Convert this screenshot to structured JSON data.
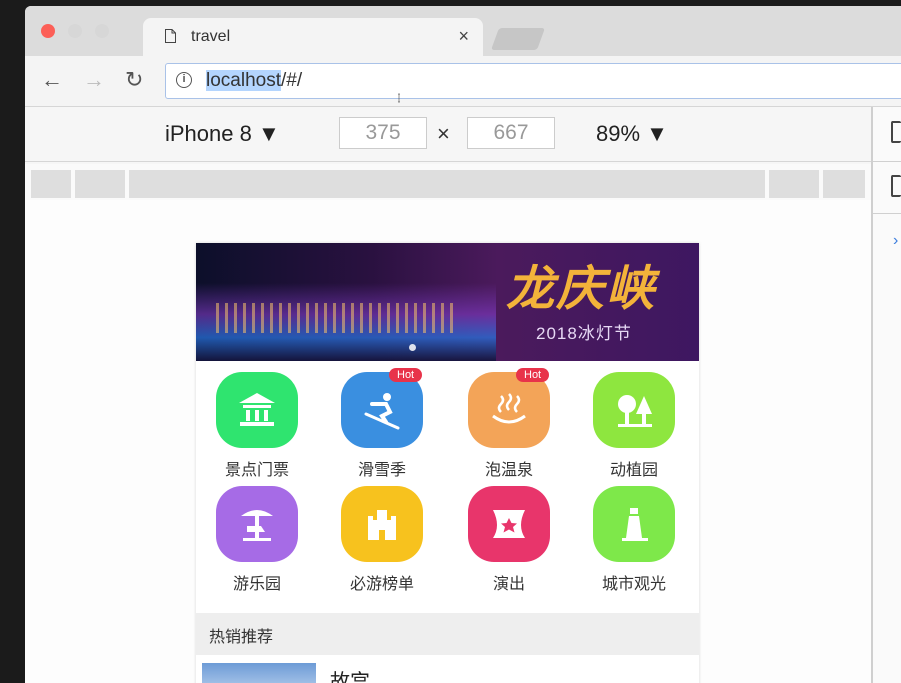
{
  "browser": {
    "tab_title": "travel",
    "tab_close": "×",
    "url_host": "localhost",
    "url_rest": "/#/",
    "nav": {
      "back": "←",
      "forward": "→",
      "reload": "↻"
    }
  },
  "device_toolbar": {
    "device": "iPhone 8 ▼",
    "width": "375",
    "times": "×",
    "height": "667",
    "zoom": "89% ▼"
  },
  "devtools": {
    "arrow": "›"
  },
  "app": {
    "banner": {
      "title": "龙庆峡",
      "subtitle": "2018冰灯节"
    },
    "icons": [
      {
        "label": "景点门票",
        "color": "#2fe46f",
        "badge": ""
      },
      {
        "label": "滑雪季",
        "color": "#3a8fe0",
        "badge": "Hot"
      },
      {
        "label": "泡温泉",
        "color": "#f3a458",
        "badge": "Hot"
      },
      {
        "label": "动植园",
        "color": "#8ee63f",
        "badge": ""
      },
      {
        "label": "游乐园",
        "color": "#a66be6",
        "badge": ""
      },
      {
        "label": "必游榜单",
        "color": "#f7c21e",
        "badge": ""
      },
      {
        "label": "演出",
        "color": "#e8356b",
        "badge": ""
      },
      {
        "label": "城市观光",
        "color": "#7ee84a",
        "badge": ""
      }
    ],
    "section_title": "热销推荐",
    "first_item": "故宫"
  }
}
